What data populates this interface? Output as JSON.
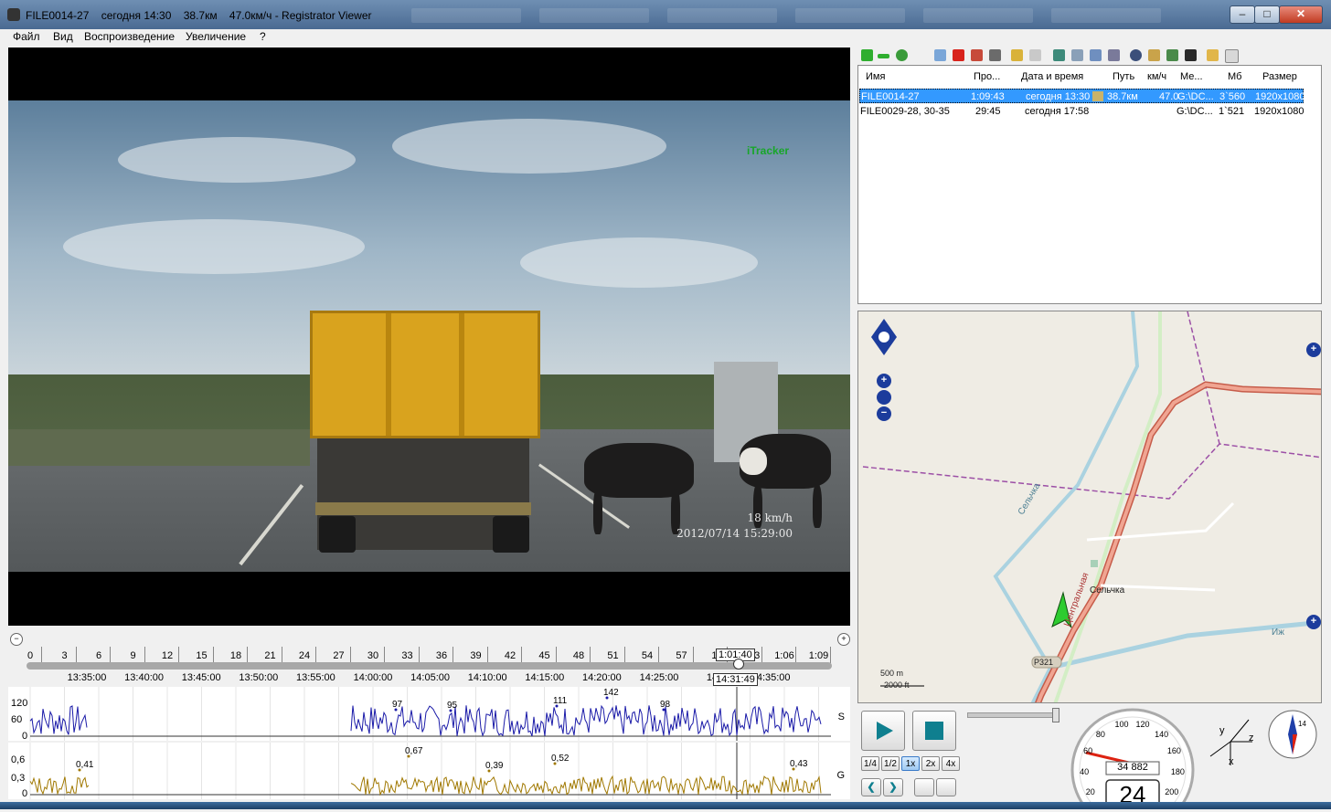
{
  "window": {
    "title": "FILE0014-27    сегодня 14:30    38.7км    47.0км/ч - Registrator Viewer",
    "minimize": "–",
    "maximize": "□",
    "close": "✕"
  },
  "menu": [
    "Файл",
    "Вид",
    "Воспроизведение",
    "Увеличение",
    "?"
  ],
  "video": {
    "brand_overlay": "iTracker",
    "speed_overlay": "18 km/h",
    "datetime_overlay": "2012/07/14  15:29:00"
  },
  "timeline": {
    "minute_ticks": [
      "0",
      "3",
      "6",
      "9",
      "12",
      "15",
      "18",
      "21",
      "24",
      "27",
      "30",
      "33",
      "36",
      "39",
      "42",
      "45",
      "48",
      "51",
      "54",
      "57",
      "1:",
      "1:03",
      "1:06",
      "1:09"
    ],
    "clock_labels": [
      "13:35:00",
      "13:40:00",
      "13:45:00",
      "13:50:00",
      "13:55:00",
      "14:00:00",
      "14:05:00",
      "14:10:00",
      "14:15:00",
      "14:20:00",
      "14:25:00",
      "14:3",
      "4:35:00"
    ],
    "cursor_elapsed": "1:01:40",
    "cursor_clock": "14:31:49"
  },
  "speed_graph": {
    "y_labels": [
      "120",
      "60",
      "0"
    ],
    "side_label": "S",
    "peak_labels": [
      "97",
      "95",
      "111",
      "142",
      "98"
    ]
  },
  "g_graph": {
    "y_labels": [
      "0,6",
      "0,3",
      "0"
    ],
    "side_label": "G",
    "peak_labels": [
      "0,41",
      "0,67",
      "0,39",
      "0,52",
      "0,43"
    ]
  },
  "file_list": {
    "columns": [
      "Имя",
      "Про...",
      "Дата и время",
      "Путь",
      "км/ч",
      "Ме...",
      "Мб",
      "Размер"
    ],
    "rows": [
      {
        "name": "FILE0014-27",
        "duration": "1:09:43",
        "date": "сегодня 13:30",
        "distance": "38.7км",
        "speed": "47.0",
        "location": "G:\\DC...",
        "mb": "3`560",
        "size": "1920x1080",
        "selected": true
      },
      {
        "name": "FILE0029-28, 30-35",
        "duration": "29:45",
        "date": "сегодня 17:58",
        "distance": "",
        "speed": "",
        "location": "G:\\DC...",
        "mb": "1`521",
        "size": "1920x1080",
        "selected": false
      }
    ]
  },
  "map": {
    "town": "Сельчка",
    "river": "Сельчка",
    "road_vertical": "Центральная",
    "road_badge": "Р321",
    "road_right": "Иж",
    "scale_metric": "500 m",
    "scale_imperial": "2000 ft"
  },
  "playback": {
    "speeds": [
      "1/4",
      "1/2",
      "1x",
      "2x",
      "4x"
    ],
    "active_speed": "1x"
  },
  "speedometer": {
    "current_speed": "24",
    "odometer": "34 882",
    "dial_labels": [
      "20",
      "40",
      "60",
      "80",
      "100",
      "120",
      "140",
      "160",
      "180",
      "200"
    ]
  },
  "compass": {
    "heading_label": "14"
  },
  "axes_widget": {
    "labels": [
      "y",
      "z",
      "x"
    ]
  },
  "colors": {
    "speed_line": "#1a1aa8",
    "g_line": "#a07800",
    "selection": "#3399ff",
    "route": "#e07868"
  }
}
